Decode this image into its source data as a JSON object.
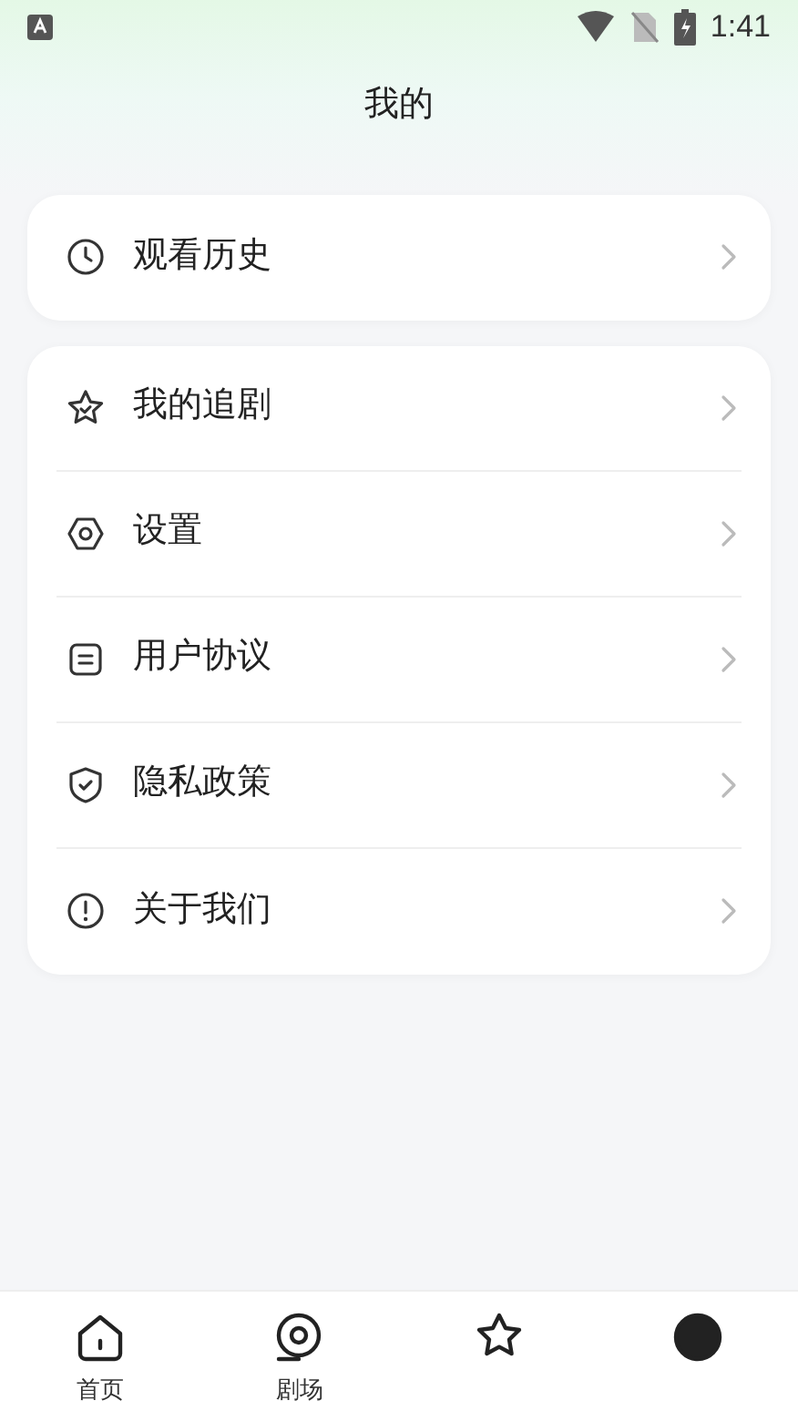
{
  "status_bar": {
    "time": "1:41"
  },
  "header": {
    "title": "我的"
  },
  "groups": [
    {
      "items": [
        {
          "kind": "history",
          "label": "观看历史"
        }
      ]
    },
    {
      "items": [
        {
          "kind": "follow",
          "label": "我的追剧"
        },
        {
          "kind": "settings",
          "label": "设置"
        },
        {
          "kind": "agreement",
          "label": "用户协议"
        },
        {
          "kind": "privacy",
          "label": "隐私政策"
        },
        {
          "kind": "about",
          "label": "关于我们"
        }
      ]
    }
  ],
  "tab_bar": [
    {
      "kind": "home",
      "label": "首页",
      "selected": false
    },
    {
      "kind": "theater",
      "label": "剧场",
      "selected": false
    },
    {
      "kind": "star",
      "selected": false
    },
    {
      "kind": "profile",
      "selected": true
    }
  ]
}
